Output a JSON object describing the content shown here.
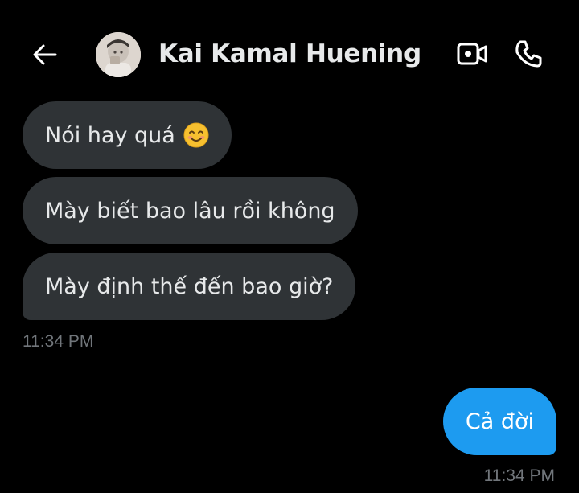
{
  "header": {
    "title": "Kai Kamal Huening",
    "back_icon": "arrow-left-icon",
    "video_icon": "video-call-icon",
    "phone_icon": "phone-call-icon"
  },
  "messages": {
    "incoming": [
      {
        "text": "Nói hay quá",
        "emoji": "smiling-face-icon"
      },
      {
        "text": "Mày biết bao lâu rồi không"
      },
      {
        "text": "Mày định thế đến bao giờ?"
      }
    ],
    "incoming_time": "11:34 PM",
    "outgoing": [
      {
        "text": "Cả đời"
      }
    ],
    "outgoing_time": "11:34 PM"
  },
  "colors": {
    "background": "#000000",
    "incoming_bubble": "#2f3336",
    "outgoing_bubble": "#1d9bf0",
    "timestamp": "#71767b",
    "text": "#e7e9ea"
  }
}
